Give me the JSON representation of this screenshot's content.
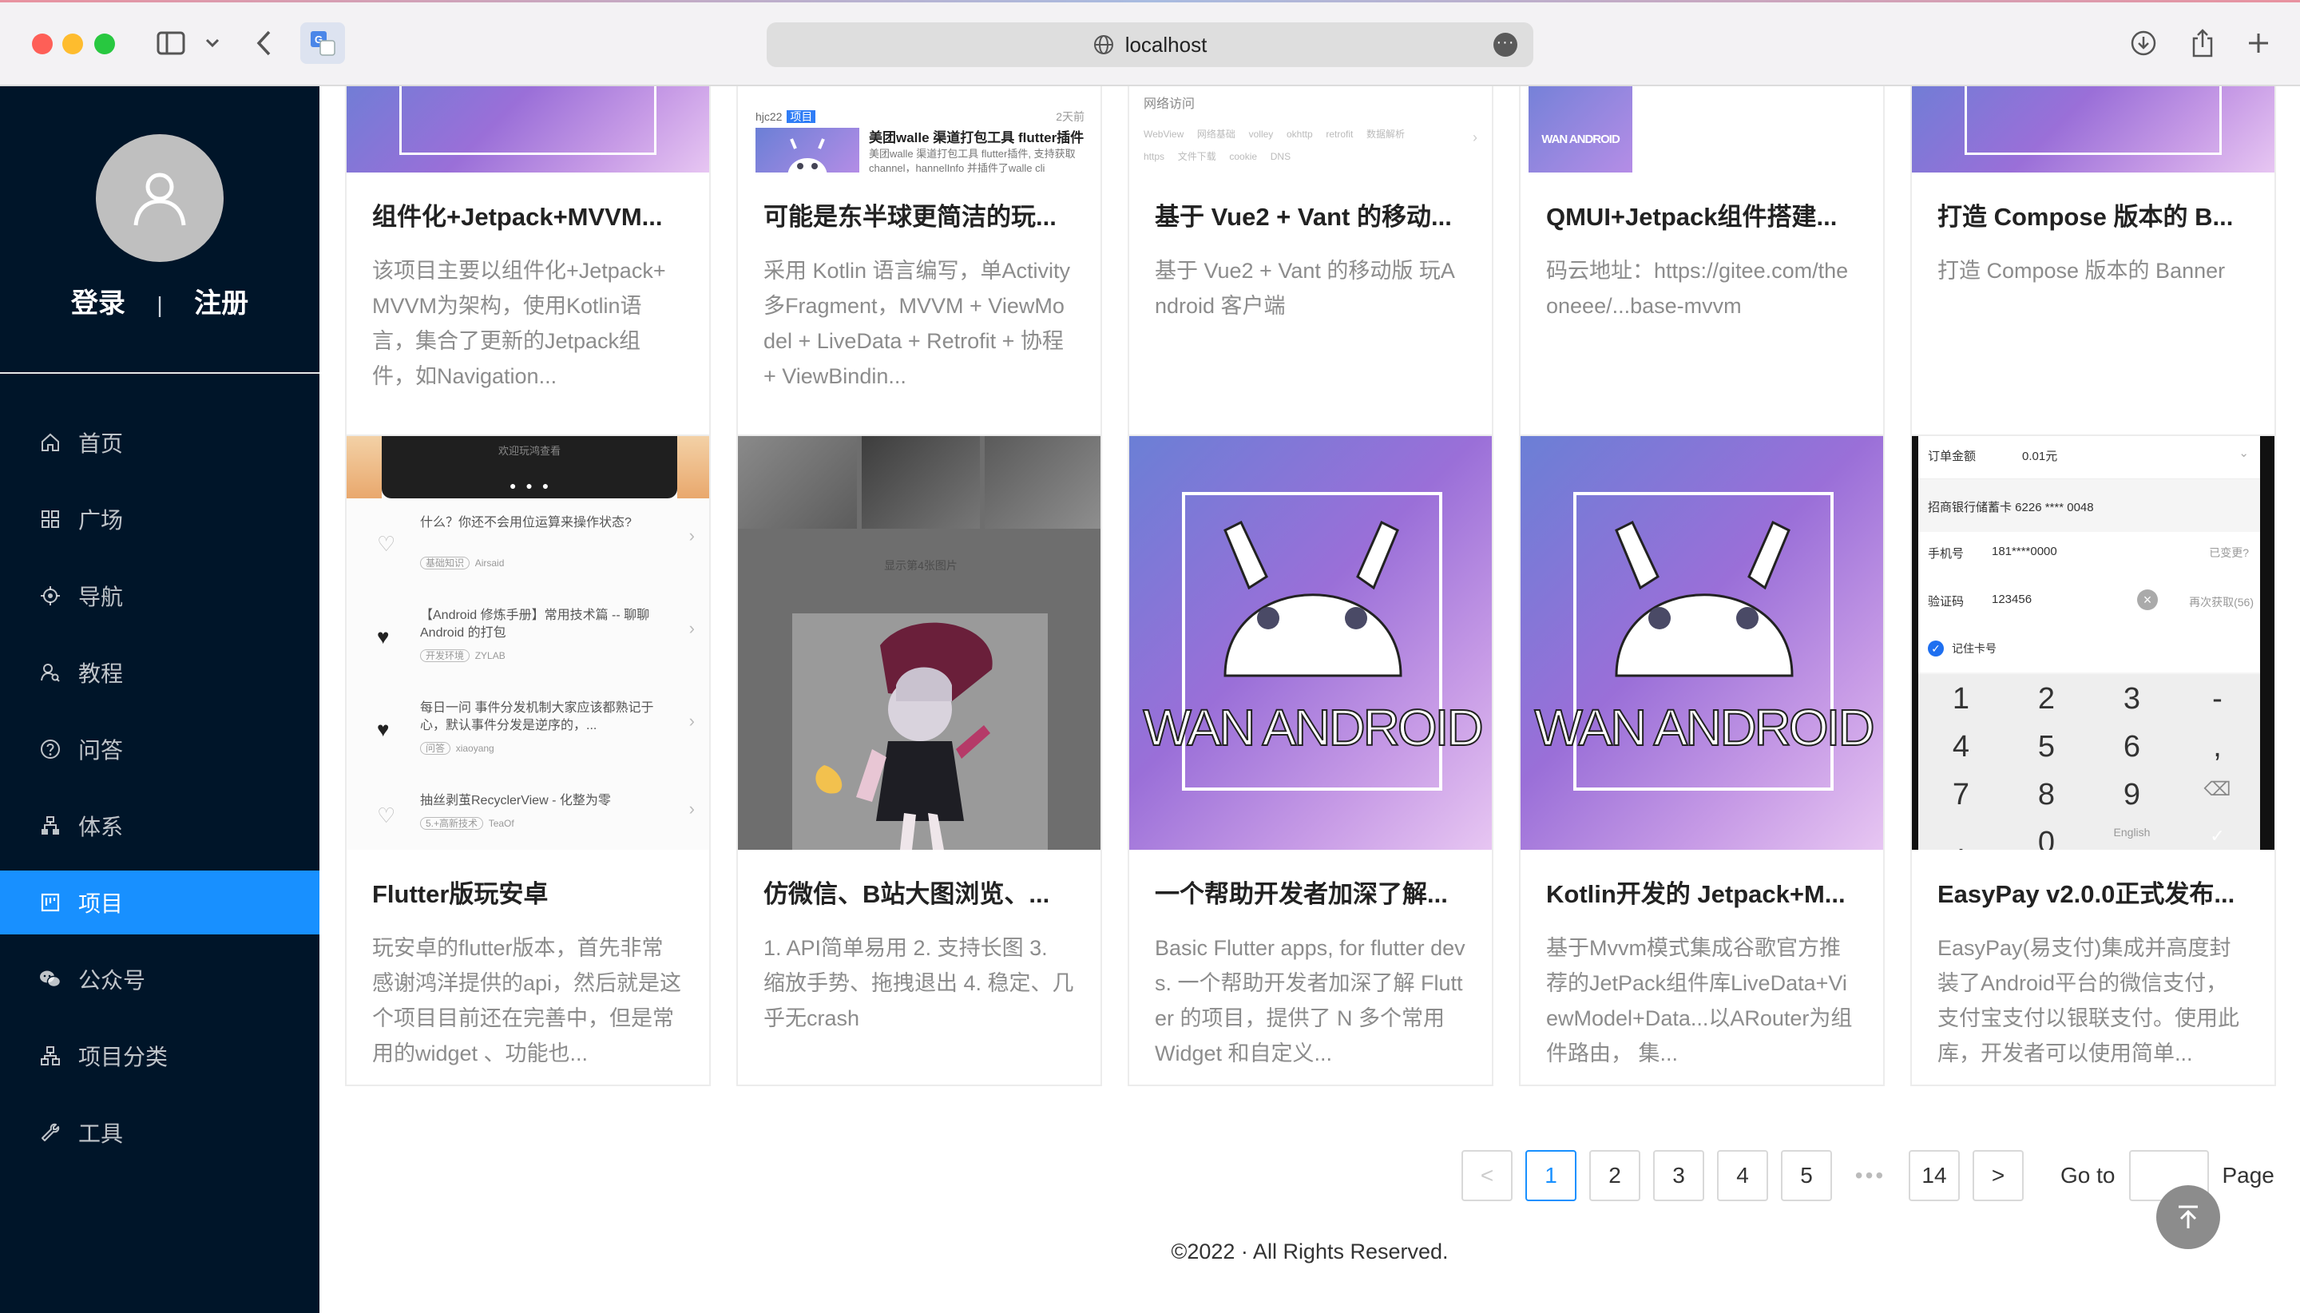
{
  "browser": {
    "url": "localhost"
  },
  "auth": {
    "login": "登录",
    "separator": "|",
    "register": "注册"
  },
  "menu": [
    {
      "label": "首页",
      "icon": "home-icon"
    },
    {
      "label": "广场",
      "icon": "grid-icon"
    },
    {
      "label": "导航",
      "icon": "compass-icon"
    },
    {
      "label": "教程",
      "icon": "user-search-icon"
    },
    {
      "label": "问答",
      "icon": "question-icon"
    },
    {
      "label": "体系",
      "icon": "tree-icon"
    },
    {
      "label": "项目",
      "icon": "project-icon"
    },
    {
      "label": "公众号",
      "icon": "wechat-icon"
    },
    {
      "label": "项目分类",
      "icon": "hierarchy-icon"
    },
    {
      "label": "工具",
      "icon": "tool-icon"
    }
  ],
  "active_menu": "项目",
  "cards_row1": [
    {
      "title": "组件化+Jetpack+MVVM...",
      "desc": "该项目主要以组件化+Jetpack+MVVM为架构，使用Kotlin语言，集合了更新的Jetpack组件，如Navigation..."
    },
    {
      "title": "可能是东半球更简洁的玩...",
      "desc": "采用 Kotlin 语言编写，单Activity多Fragment，MVVM + ViewModel + LiveData + Retrofit + 协程 + ViewBindin..."
    },
    {
      "title": "基于 Vue2 + Vant 的移动...",
      "desc": "基于 Vue2 + Vant 的移动版 玩Android 客户端"
    },
    {
      "title": "QMUI+Jetpack组件搭建...",
      "desc": "码云地址：https://gitee.com/theoneee/...base-mvvm"
    },
    {
      "title": "打造 Compose 版本的 B...",
      "desc": "打造 Compose 版本的 Banner"
    }
  ],
  "cards_row2": [
    {
      "title": "Flutter版玩安卓",
      "desc": "玩安卓的flutter版本，首先非常感谢鸿洋提供的api，然后就是这个项目目前还在完善中，但是常用的widget 、功能也..."
    },
    {
      "title": "仿微信、B站大图浏览、...",
      "desc": "1. API简单易用 2. 支持长图 3. 缩放手势、拖拽退出 4. 稳定、几乎无crash"
    },
    {
      "title": "一个帮助开发者加深了解...",
      "desc": "Basic Flutter apps, for flutter devs. 一个帮助开发者加深了解 Flutter 的项目，提供了 N 多个常用 Widget 和自定义..."
    },
    {
      "title": "Kotlin开发的 Jetpack+M...",
      "desc": "基于Mvvm模式集成谷歌官方推荐的JetPack组件库LiveData+ViewModel+Data...以ARouter为组件路由， 集..."
    },
    {
      "title": "EasyPay v2.0.0正式发布...",
      "desc": "EasyPay(易支付)集成并高度封装了Android平台的微信支付，支付宝支付以银联支付。使用此库，开发者可以使用简单..."
    }
  ],
  "covers": {
    "wan_text": "WAN ANDROID",
    "hjc_author": "hjc22",
    "hjc_tag": "项目",
    "hjc_time": "2天前",
    "hjc_title": "美团walle 渠道打包工具 flutter插件",
    "hjc_sub": "美团walle 渠道打包工具 flutter插件, 支持获取channel，hannelInfo 并插件了walle cli",
    "vue_heading": "网络访问",
    "vue_tags": [
      "WebView",
      "网络基础",
      "volley",
      "okhttp",
      "retrofit",
      "数据解析",
      "https",
      "文件下载",
      "cookie",
      "DNS"
    ],
    "flutter_banner": "欢迎玩鸿查看",
    "flutter_items": [
      {
        "q": "什么？你还不会用位运算来操作状态?",
        "tag": "基础知识",
        "author": "Airsaid"
      },
      {
        "q": "【Android 修炼手册】常用技术篇 -- 聊聊 Android 的打包",
        "tag": "开发环境",
        "author": "ZYLAB"
      },
      {
        "q": "每日一问 事件分发机制大家应该都熟记于心，默认事件分发是逆序的，...",
        "tag": "问答",
        "author": "xiaoyang"
      },
      {
        "q": "抽丝剥茧RecyclerView - 化整为零",
        "tag": "5.+高新技术",
        "author": "TeaOf"
      }
    ],
    "image_preview_hint": "显示第4张图片",
    "pay": {
      "amount_label": "订单金额",
      "amount": "0.01元",
      "bank": "招商银行储蓄卡 6226 **** 0048",
      "phone_label": "手机号",
      "phone": "181****0000",
      "phone_change": "已变更?",
      "code_label": "验证码",
      "code": "123456",
      "resend": "再次获取(56)",
      "remember": "记住卡号",
      "keys": [
        "1",
        "2",
        "3",
        "-",
        "4",
        "5",
        "6",
        ",",
        "7",
        "8",
        "9",
        "⌫",
        ".",
        "0",
        "English",
        "✓"
      ]
    }
  },
  "pagination": {
    "prev": "<",
    "pages": [
      "1",
      "2",
      "3",
      "4",
      "5"
    ],
    "ellipsis": "•••",
    "last": "14",
    "next": ">",
    "current": "1",
    "goto_label": "Go to",
    "page_label": "Page"
  },
  "footer": "©2022 · All Rights Reserved."
}
